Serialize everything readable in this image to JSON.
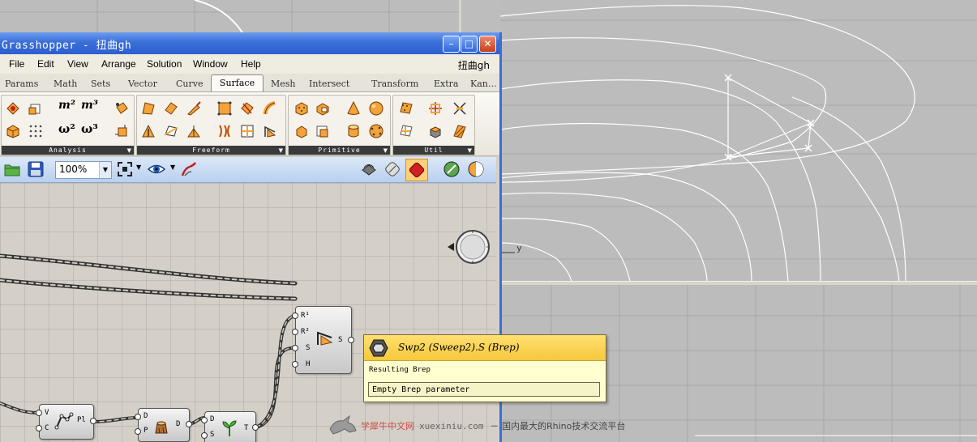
{
  "window": {
    "title": "Grasshopper - 扭曲gh",
    "minimize_glyph": "–",
    "maximize_glyph": "□",
    "close_glyph": "✕"
  },
  "menu": {
    "items": [
      "File",
      "Edit",
      "View",
      "Arrange",
      "Solution",
      "Window",
      "Help"
    ],
    "document_name": "扭曲gh"
  },
  "tabs": {
    "items": [
      "Params",
      "Math",
      "Sets",
      "Vector",
      "Curve",
      "Surface",
      "Mesh",
      "Intersect",
      "Transform",
      "Extra",
      "Kan…"
    ],
    "active": "Surface"
  },
  "ribbon": {
    "groups": [
      "Analysis",
      "Freeform",
      "Primitive",
      "Util"
    ]
  },
  "toolbar": {
    "zoom": "100%"
  },
  "viewport": {
    "axis_label": "y"
  },
  "components": {
    "sweep": {
      "inputs": [
        "R¹",
        "R²",
        "S",
        "H"
      ],
      "output": "S"
    },
    "polyline": {
      "inputs": [
        "V",
        "C"
      ],
      "output": "Pl"
    },
    "prune": {
      "inputs": [
        "D",
        "P"
      ],
      "output": "D"
    },
    "graft": {
      "inputs": [
        "D",
        "S"
      ],
      "output": "T"
    }
  },
  "tooltip": {
    "title": "Swp2 (Sweep2).S (Brep)",
    "description": "Resulting Brep",
    "value": "Empty Brep parameter"
  },
  "watermark": {
    "site": "学犀牛中文网",
    "url": "xuexiniu.com",
    "description": "－ 国内最大的Rhino技术交流平台"
  }
}
